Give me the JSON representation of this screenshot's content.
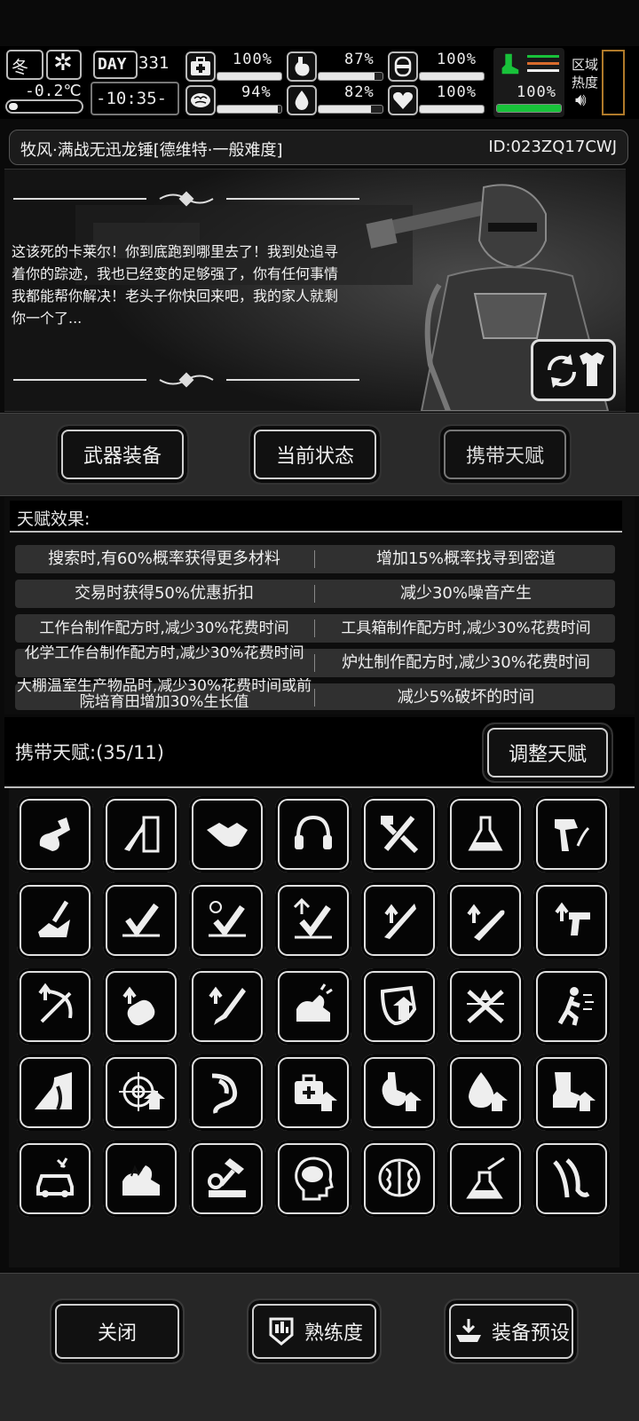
{
  "hud": {
    "season": "冬",
    "weather_symbol": "*",
    "temperature": "-0.2℃",
    "day_label": "DAY",
    "day_number": "331",
    "clock": "-10:35-",
    "stats": [
      {
        "icon": "medkit-icon",
        "value": "100%",
        "level": 1.0
      },
      {
        "icon": "stomach-icon",
        "value": "87%",
        "level": 0.87
      },
      {
        "icon": "lungs-icon",
        "value": "100%",
        "level": 1.0
      },
      {
        "icon": "brain-icon",
        "value": "94%",
        "level": 0.94
      },
      {
        "icon": "water-drop-icon",
        "value": "82%",
        "level": 0.82
      },
      {
        "icon": "heart-icon",
        "value": "100%",
        "level": 1.0
      }
    ],
    "leg_status": {
      "icon": "leg-icon",
      "value": "100%",
      "level": 1.0,
      "color": "#18c23a"
    },
    "zone_heat_label_1": "区域",
    "zone_heat_label_2": "热度"
  },
  "title": {
    "name": "牧风·满战无迅龙锤[德维特·一般难度]",
    "id": "ID:023ZQ17CWJ"
  },
  "story": {
    "quote": "这该死的卡莱尔！你到底跑到哪里去了！我到处追寻着你的踪迹，我也已经变的足够强了，你有任何事情我都能帮你解决！老头子你快回来吧，我的家人就剩你一个了..."
  },
  "tabs": [
    {
      "label": "武器装备"
    },
    {
      "label": "当前状态"
    },
    {
      "label": "携带天赋"
    }
  ],
  "effects": {
    "header": "天赋效果:",
    "rows": [
      [
        "搜索时,有60%概率获得更多材料",
        "增加15%概率找寻到密道"
      ],
      [
        "交易时获得50%优惠折扣",
        "减少30%噪音产生"
      ],
      [
        "工作台制作配方时,减少30%花费时间",
        "工具箱制作配方时,减少30%花费时间"
      ],
      [
        "化学工作台制作配方时,减少30%花费时间",
        "炉灶制作配方时,减少30%花费时间"
      ],
      [
        "大棚温室生产物品时,减少30%花费时间或前院培育田增加30%生长值",
        "减少5%破坏的时间"
      ]
    ]
  },
  "carried": {
    "label": "携带天赋:(35/11)",
    "adjust_button": "调整天赋"
  },
  "talents": [
    "scavenge-bag-icon",
    "torch-door-icon",
    "handshake-icon",
    "headphones-icon",
    "tools-icon",
    "flask-icon",
    "hammer-plant-icon",
    "break-wood-icon",
    "stealth-speed-icon",
    "timed-run-icon",
    "agility-up-icon",
    "blade-up-icon",
    "bat-up-icon",
    "pistol-up-icon",
    "crossbow-up-icon",
    "glove-up-icon",
    "syringe-up-icon",
    "strength-icon",
    "shield-up-icon",
    "crossed-swords-icon",
    "sprint-icon",
    "road-icon",
    "target-up-icon",
    "intestine-icon",
    "medkit-up-icon",
    "stomach-up-icon",
    "water-up-icon",
    "leg-up-icon",
    "car-repair-icon",
    "strength-fire-icon",
    "gear-hammer-icon",
    "head-brain-icon",
    "brain-icon",
    "chem-pour-icon",
    "tentacle-icon"
  ],
  "footer": {
    "close": "关闭",
    "proficiency": "熟练度",
    "preset": "装备预设"
  }
}
